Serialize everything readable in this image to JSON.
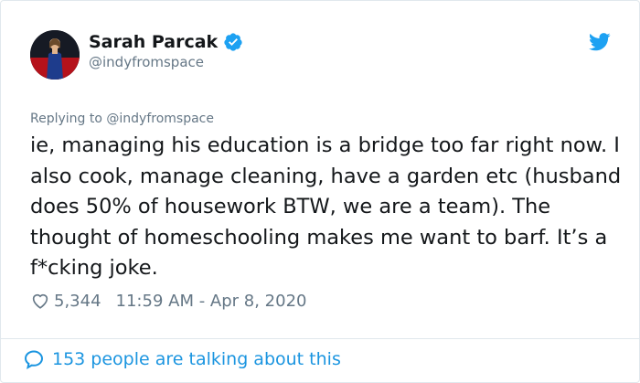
{
  "author": {
    "name": "Sarah Parcak",
    "handle": "@indyfromspace",
    "verified": true
  },
  "reply": {
    "prefix": "Replying to",
    "target": "@indyfromspace"
  },
  "tweet": {
    "text": "ie, managing his education is a bridge too far right now. I also cook, manage cleaning, have a garden etc (husband does 50% of housework BTW, we are a team). The thought of homeschooling makes me want to barf. It’s a f*cking joke."
  },
  "meta": {
    "likes": "5,344",
    "timestamp": "11:59 AM - Apr 8, 2020"
  },
  "conversation": {
    "label": "153 people are talking about this"
  },
  "colors": {
    "accent": "#1b95e0",
    "muted": "#657786",
    "text": "#14171a",
    "border": "#e1e8ed"
  },
  "icons": [
    "verified-badge-icon",
    "twitter-bird-icon",
    "heart-icon",
    "speech-bubble-icon"
  ]
}
